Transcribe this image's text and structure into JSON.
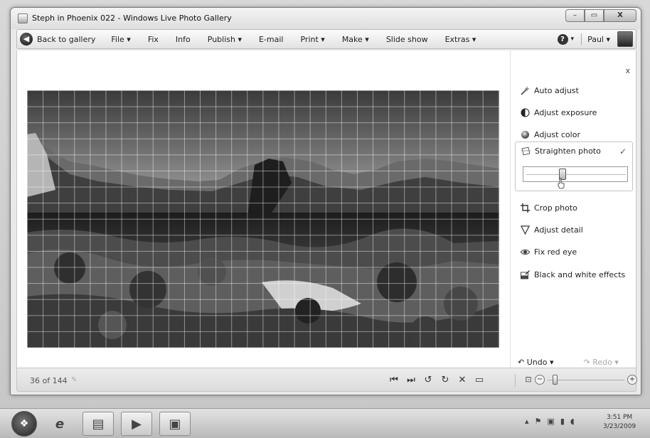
{
  "window": {
    "title": "Steph in Phoenix 022 - Windows Live Photo Gallery",
    "controls": {
      "minimize": "–",
      "maximize": "▭",
      "close": "X"
    }
  },
  "toolbar": {
    "back": "Back to gallery",
    "file": "File ▾",
    "fix": "Fix",
    "info": "Info",
    "publish": "Publish ▾",
    "email": "E-mail",
    "print": "Print ▾",
    "make": "Make ▾",
    "slideshow": "Slide show",
    "extras": "Extras ▾",
    "help": "?",
    "help_arrow": "▾",
    "user": "Paul ▾"
  },
  "fix_panel": {
    "close": "x",
    "auto_adjust": "Auto adjust",
    "adjust_exposure": "Adjust exposure",
    "adjust_color": "Adjust color",
    "straighten_photo": "Straighten photo",
    "straighten_check": "✓",
    "straighten_value": 0.35,
    "crop_photo": "Crop photo",
    "adjust_detail": "Adjust detail",
    "fix_red_eye": "Fix red eye",
    "bw_effects": "Black and white effects",
    "undo": "Undo ▾",
    "redo": "Redo ▾"
  },
  "statusbar": {
    "count": "36 of 144",
    "zoom_level": 0.07
  },
  "taskbar": {
    "clock_time": "3:51 PM",
    "clock_date": "3/23/2009"
  },
  "icons": {
    "back": "back-arrow-icon",
    "help": "help-icon",
    "auto_adjust": "magic-wand-icon",
    "exposure": "half-circle-icon",
    "color": "color-sphere-icon",
    "straighten": "straighten-icon",
    "crop": "crop-icon",
    "detail": "triangle-icon",
    "red_eye": "eye-icon",
    "bw": "bw-effects-icon"
  }
}
